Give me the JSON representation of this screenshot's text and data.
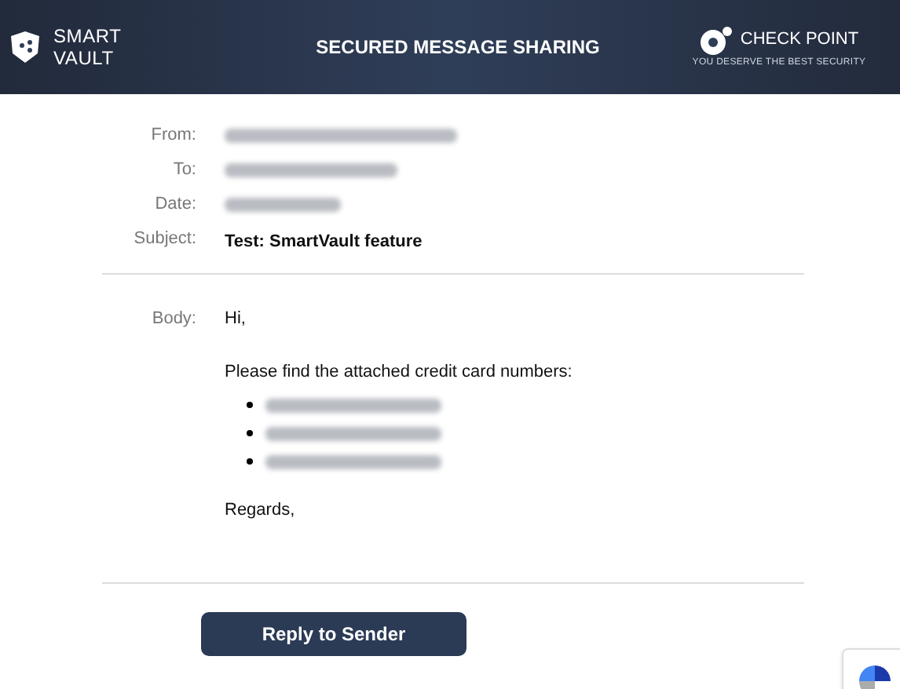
{
  "header": {
    "logo": {
      "line_1": "SMART",
      "line_2": "VAULT"
    },
    "title": "SECURED MESSAGE SHARING",
    "brand": {
      "name": "CHECK POINT",
      "tagline": "YOU DESERVE THE BEST SECURITY"
    }
  },
  "fields": [
    {
      "label": "From:",
      "kind": "redacted"
    },
    {
      "label": "To:",
      "kind": "redacted"
    },
    {
      "label": "Date:",
      "kind": "redacted"
    },
    {
      "label": "Subject:",
      "kind": "text",
      "value": "Test: SmartVault feature"
    }
  ],
  "body": {
    "label": "Body:",
    "greeting": "Hi,",
    "intro": "Please find the attached credit card numbers:",
    "items": [
      {
        "kind": "redacted"
      },
      {
        "kind": "redacted"
      },
      {
        "kind": "redacted"
      }
    ],
    "closing": "Regards,"
  },
  "reply_button": "Reply to Sender"
}
